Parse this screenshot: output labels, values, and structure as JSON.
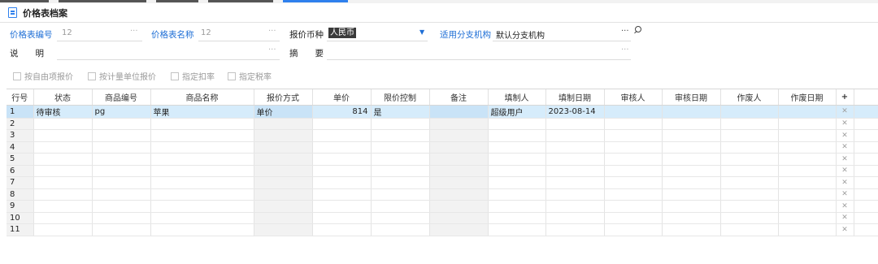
{
  "page": {
    "title": "价格表档案"
  },
  "form": {
    "code_label": "价格表编号",
    "code_value": "12",
    "name_label": "价格表名称",
    "name_value": "12",
    "currency_label": "报价币种",
    "currency_value": "人民币",
    "branch_label": "适用分支机构",
    "branch_value": "默认分支机构",
    "desc_label": "说　　明",
    "desc_value": "",
    "summary_label": "摘　　要",
    "summary_value": "",
    "dots": "···"
  },
  "checks": [
    {
      "label": "按自由项报价",
      "checked": false
    },
    {
      "label": "按计量单位报价",
      "checked": false
    },
    {
      "label": "指定扣率",
      "checked": false
    },
    {
      "label": "指定税率",
      "checked": false
    }
  ],
  "table": {
    "headers": [
      "行号",
      "状态",
      "商品编号",
      "商品名称",
      "报价方式",
      "单价",
      "限价控制",
      "备注",
      "填制人",
      "填制日期",
      "审核人",
      "审核日期",
      "作废人",
      "作废日期",
      "+"
    ],
    "rows": [
      {
        "row": "1",
        "status": "待审核",
        "code": "pg",
        "name": "苹果",
        "mode": "单价",
        "price": "814",
        "limit": "是",
        "note": "",
        "maker": "超级用户",
        "date": "2023-08-14",
        "auditor": "",
        "audit_date": "",
        "voider": "",
        "void_date": ""
      },
      {
        "row": "2"
      },
      {
        "row": "3"
      },
      {
        "row": "4"
      },
      {
        "row": "5"
      },
      {
        "row": "6"
      },
      {
        "row": "7"
      },
      {
        "row": "8"
      },
      {
        "row": "9"
      },
      {
        "row": "10"
      },
      {
        "row": "11"
      }
    ],
    "delete_glyph": "✕"
  }
}
